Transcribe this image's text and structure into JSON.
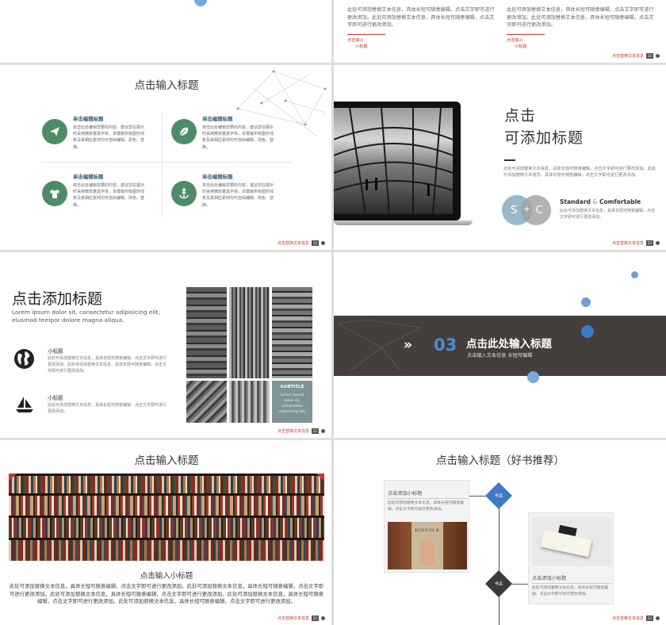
{
  "colors": {
    "accent_red": "#c0392b",
    "green": "#4e8c67",
    "dark_band": "#443f3d",
    "blue": "#3c79c6",
    "gray_text": "#666666"
  },
  "footer": {
    "label": "点击替换文本信息",
    "page": "22"
  },
  "s1": {
    "col1_text": "此处可添加替换文本信息，具体长短可随意编辑，点击文字即可进行更改添加。此处可添加替换文本信息，具体长短可随意编辑，点击文字即可进行更改添加。",
    "col2_text": "此处可添加替换文本信息，具体长短可随意编辑，点击文字即可进行更改添加。此处可添加替换文本信息，具体长短可随意编辑，点击文字即可进行更改添加。",
    "link_line1": "点击输入",
    "link_line2": "小标题"
  },
  "s2": {
    "title": "点击输入标题",
    "features": [
      {
        "icon": "paper-plane-icon",
        "title": "单击编辑标题",
        "text": "单击此处编辑您要的内容，建议您在展示时采用微软雅黑字体，本模板所有图形线条及其相应素材均可自由编辑、改色、替换。"
      },
      {
        "icon": "leaf-icon",
        "title": "单击编辑标题",
        "text": "单击此处编辑您要的内容，建议您在展示时采用微软雅黑字体，本模板所有图形线条及其相应素材均可自由编辑、改色、替换。"
      },
      {
        "icon": "tshirt-icon",
        "title": "单击编辑标题",
        "text": "单击此处编辑您要的内容，建议您在展示时采用微软雅黑字体，本模板所有图形线条及其相应素材均可自由编辑、改色、替换。"
      },
      {
        "icon": "anchor-icon",
        "title": "单击编辑标题",
        "text": "单击此处编辑您要的内容，建议您在展示时采用微软雅黑字体，本模板所有图形线条及其相应素材均可自由编辑、改色、替换。"
      }
    ]
  },
  "s3": {
    "title_line1": "点击",
    "title_line2": "可添加标题",
    "body": "此处可添加替换文本信息，具体长短可随意编辑，点击文字即可进行更改添加。此处可添加替换文本信息，具体长短可随意编辑，点击文字即可进行更改添加。",
    "circle_s": "S",
    "circle_plus": "+",
    "circle_c": "C",
    "tag_a": "Standard",
    "tag_amp": "&",
    "tag_b": "Comfortable",
    "tag_text": "此处可添加替换文本信息，具体长短可随意编辑，点击文字即可进行更改添加。"
  },
  "s4": {
    "title": "点击添加标题",
    "lorem": "Lorem ipsum dolor sit, consectetur adipisicing elit, eiusmod tempor dolore magna aliqua.",
    "items": [
      {
        "icon": "globe-icon",
        "title": "小标题",
        "text": "此处可添加替换文本信息，具体长短可随意编辑，点击文字即可进行更改添加。此处可添加替换文本信息，具体长短可随意编辑，点击文字即可进行更改添加。"
      },
      {
        "icon": "sailboat-icon",
        "title": "小标题",
        "text": "此处可添加替换文本信息，具体长短可随意编辑，点击文字即可进行更改添加。"
      }
    ],
    "subtitle": "SUBTITLE",
    "subtitle_text": "Lorem ipsum dolor sit, consectetur adipisicing elit."
  },
  "s5": {
    "number": "03",
    "title": "点击此处输入标题",
    "subtitle": "点击输入文本信息 长短可编辑"
  },
  "s6": {
    "title": "点击输入标题",
    "subtitle": "点击输入小标题",
    "body": "此处可添加替换文本信息，具体长短可随意编辑，点击文字即可进行更改添加。此处可添加替换文本信息，具体长短可随意编辑，点击文字即可进行更改添加。此处可添加替换文本信息，具体长短可随意编辑，点击文字即可进行更改添加。此处可添加替换文本信息，具体长短可随意编辑，点击文字即可进行更改添加。此处可添加替换文本信息，具体长短可随意编辑，点击文字即可进行更改添加。"
  },
  "s7": {
    "title": "点击输入标题（好书推荐）",
    "card1_title": "点击添加小标题",
    "card1_text": "此处可添加替换文本信息，具体长短可随意编辑，点击文字即可进行更改添加。",
    "card2_title": "点击添加小标题",
    "card2_text": "此处可添加替换文本信息，具体长短可随意编辑，点击文字即可进行更改添加。",
    "node1": "书名",
    "node2": "书名",
    "book_cover_text": "KINFOLK"
  }
}
